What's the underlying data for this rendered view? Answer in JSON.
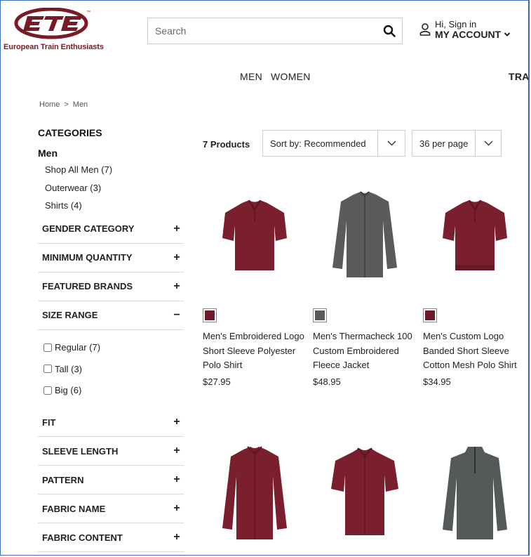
{
  "brand": {
    "caption": "European Train Enthusiasts",
    "logo_letters": "ETE",
    "tm": "™",
    "color": "#7a1a24"
  },
  "search": {
    "placeholder": "Search"
  },
  "account": {
    "greeting": "Hi, Sign in",
    "label": "MY ACCOUNT"
  },
  "nav": {
    "men": "MEN",
    "women": "WOMEN",
    "trac": "TRAC"
  },
  "breadcrumb": {
    "home": "Home",
    "separator": ">",
    "current": "Men"
  },
  "sidebar": {
    "categories_title": "CATEGORIES",
    "category": "Men",
    "items": [
      "Shop All Men (7)",
      "Outerwear (3)",
      "Shirts (4)"
    ],
    "facets_top": [
      {
        "label": "GENDER CATEGORY",
        "toggle": "+"
      },
      {
        "label": "MINIMUM QUANTITY",
        "toggle": "+"
      },
      {
        "label": "FEATURED BRANDS",
        "toggle": "+"
      },
      {
        "label": "SIZE RANGE",
        "toggle": "−"
      }
    ],
    "size_options": [
      "Regular (7)",
      "Tall (3)",
      "Big (6)"
    ],
    "facets_bottom": [
      {
        "label": "FIT",
        "toggle": "+"
      },
      {
        "label": "SLEEVE LENGTH",
        "toggle": "+"
      },
      {
        "label": "PATTERN",
        "toggle": "+"
      },
      {
        "label": "FABRIC NAME",
        "toggle": "+"
      },
      {
        "label": "FABRIC CONTENT",
        "toggle": "+"
      }
    ]
  },
  "toolbar": {
    "count": "7 Products",
    "sort": "Sort by: Recommended",
    "per_page": "36 per page"
  },
  "products": [
    {
      "name": "Men's Embroidered Logo Short Sleeve Polyester Polo Shirt",
      "price": "$27.95",
      "swatch": "#6e1a2c",
      "icon": "polo-shirt-icon"
    },
    {
      "name": "Men's Thermacheck 100 Custom Embroidered Fleece Jacket",
      "price": "$48.95",
      "swatch": "#5a5a5a",
      "icon": "fleece-jacket-icon"
    },
    {
      "name": "Men's Custom Logo Banded Short Sleeve Cotton Mesh Polo Shirt",
      "price": "$34.95",
      "swatch": "#6e1a2c",
      "icon": "polo-shirt-icon"
    },
    {
      "icon": "dress-shirt-icon"
    },
    {
      "icon": "short-sleeve-shirt-icon"
    },
    {
      "icon": "quarter-zip-icon"
    }
  ],
  "colors": {
    "maroon": "#7a1f2e",
    "gray": "#5b5b5b",
    "gray_dark": "#545a55"
  }
}
